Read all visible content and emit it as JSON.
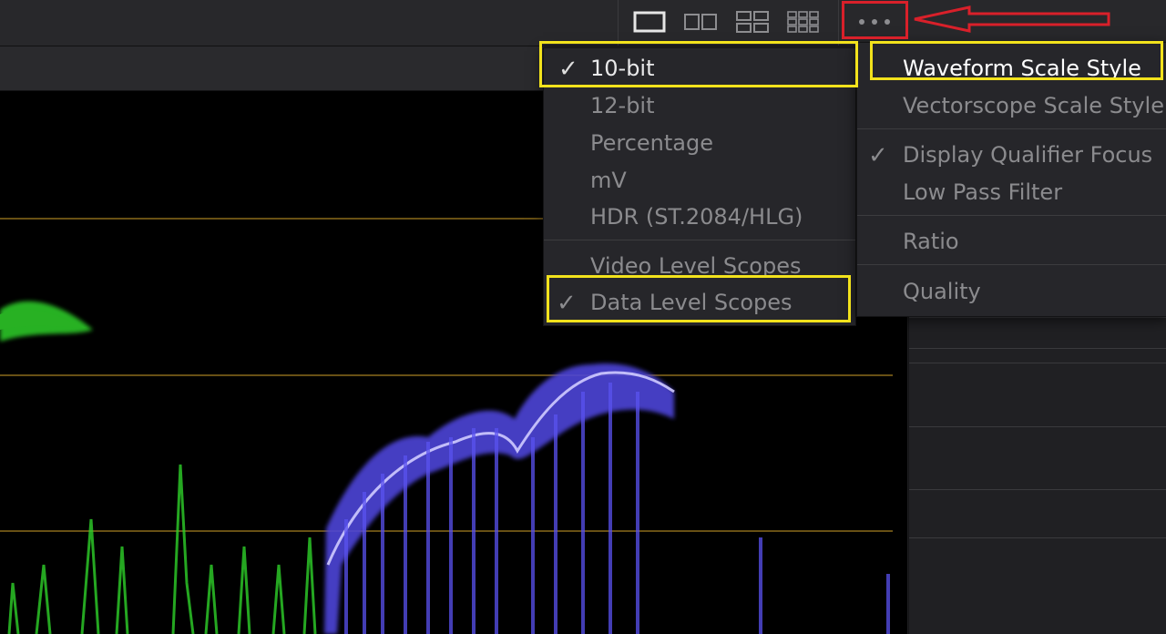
{
  "viewer_layout": {
    "buttons": [
      {
        "name": "layout-single-icon"
      },
      {
        "name": "layout-2up-icon"
      },
      {
        "name": "layout-2x2-icon"
      },
      {
        "name": "layout-3x3-icon"
      }
    ],
    "more_icon": "more-horizontal-icon"
  },
  "scale_menu": {
    "items": [
      {
        "label": "10-bit",
        "checked": true
      },
      {
        "label": "12-bit",
        "checked": false
      },
      {
        "label": "Percentage",
        "checked": false
      },
      {
        "label": "mV",
        "checked": false
      },
      {
        "label": "HDR (ST.2084/HLG)",
        "checked": false
      }
    ],
    "levels": [
      {
        "label": "Video Level Scopes",
        "checked": false
      },
      {
        "label": "Data Level Scopes",
        "checked": true
      }
    ],
    "check_glyph": "✓"
  },
  "options_menu": {
    "items": [
      {
        "label": "Waveform Scale Style",
        "checked": false,
        "active": true
      },
      {
        "label": "Vectorscope Scale Style",
        "checked": false
      },
      {
        "label": "Display Qualifier Focus",
        "checked": true
      },
      {
        "label": "Low Pass Filter",
        "checked": false
      },
      {
        "label": "Ratio",
        "checked": false
      },
      {
        "label": "Quality",
        "checked": false
      }
    ]
  },
  "colors": {
    "highlight_yellow": "#f2e21c",
    "annotation_red": "#d9202a",
    "waveform_green": "#2fd12a",
    "waveform_blue": "#5a52f0",
    "graticule": "#8a6a1a"
  }
}
